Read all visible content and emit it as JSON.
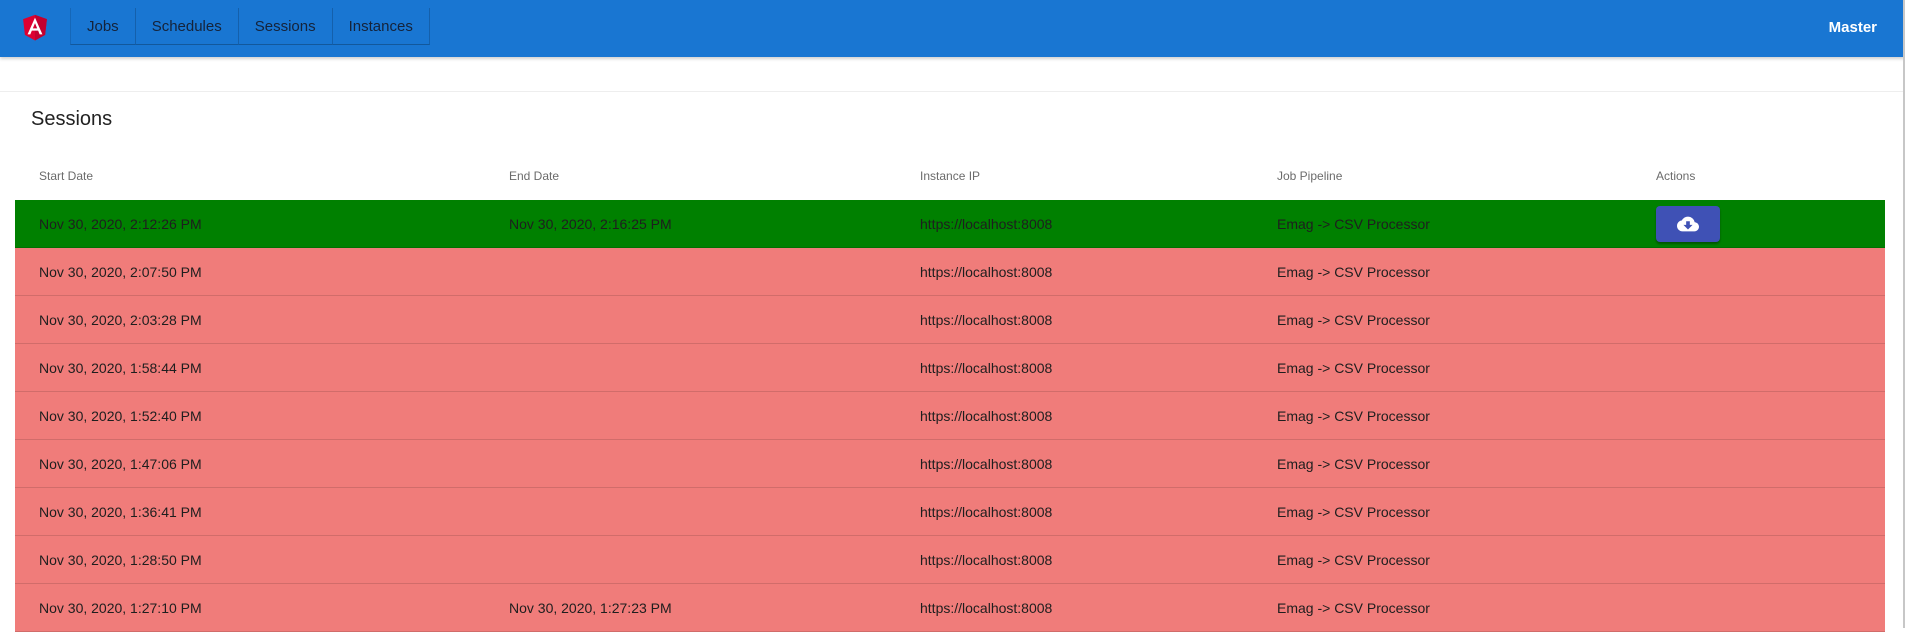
{
  "app": {
    "nav": [
      "Jobs",
      "Schedules",
      "Sessions",
      "Instances"
    ],
    "user_label": "Master"
  },
  "colors": {
    "toolbar": "#1976d2",
    "success_row": "#008000",
    "failed_row": "#f07c7a",
    "action_button": "#3f51b5",
    "logo": "#dd0031"
  },
  "page": {
    "title": "Sessions"
  },
  "table": {
    "columns": [
      "Start Date",
      "End Date",
      "Instance IP",
      "Job Pipeline",
      "Actions"
    ],
    "rows": [
      {
        "start": "Nov 30, 2020, 2:12:26 PM",
        "end": "Nov 30, 2020, 2:16:25 PM",
        "ip": "https://localhost:8008",
        "pipeline": "Emag -> CSV Processor",
        "status": "success",
        "action_icon": "cloud-download-icon"
      },
      {
        "start": "Nov 30, 2020, 2:07:50 PM",
        "end": "",
        "ip": "https://localhost:8008",
        "pipeline": "Emag -> CSV Processor",
        "status": "failed"
      },
      {
        "start": "Nov 30, 2020, 2:03:28 PM",
        "end": "",
        "ip": "https://localhost:8008",
        "pipeline": "Emag -> CSV Processor",
        "status": "failed"
      },
      {
        "start": "Nov 30, 2020, 1:58:44 PM",
        "end": "",
        "ip": "https://localhost:8008",
        "pipeline": "Emag -> CSV Processor",
        "status": "failed"
      },
      {
        "start": "Nov 30, 2020, 1:52:40 PM",
        "end": "",
        "ip": "https://localhost:8008",
        "pipeline": "Emag -> CSV Processor",
        "status": "failed"
      },
      {
        "start": "Nov 30, 2020, 1:47:06 PM",
        "end": "",
        "ip": "https://localhost:8008",
        "pipeline": "Emag -> CSV Processor",
        "status": "failed"
      },
      {
        "start": "Nov 30, 2020, 1:36:41 PM",
        "end": "",
        "ip": "https://localhost:8008",
        "pipeline": "Emag -> CSV Processor",
        "status": "failed"
      },
      {
        "start": "Nov 30, 2020, 1:28:50 PM",
        "end": "",
        "ip": "https://localhost:8008",
        "pipeline": "Emag -> CSV Processor",
        "status": "failed"
      },
      {
        "start": "Nov 30, 2020, 1:27:10 PM",
        "end": "Nov 30, 2020, 1:27:23 PM",
        "ip": "https://localhost:8008",
        "pipeline": "Emag -> CSV Processor",
        "status": "failed"
      }
    ]
  }
}
